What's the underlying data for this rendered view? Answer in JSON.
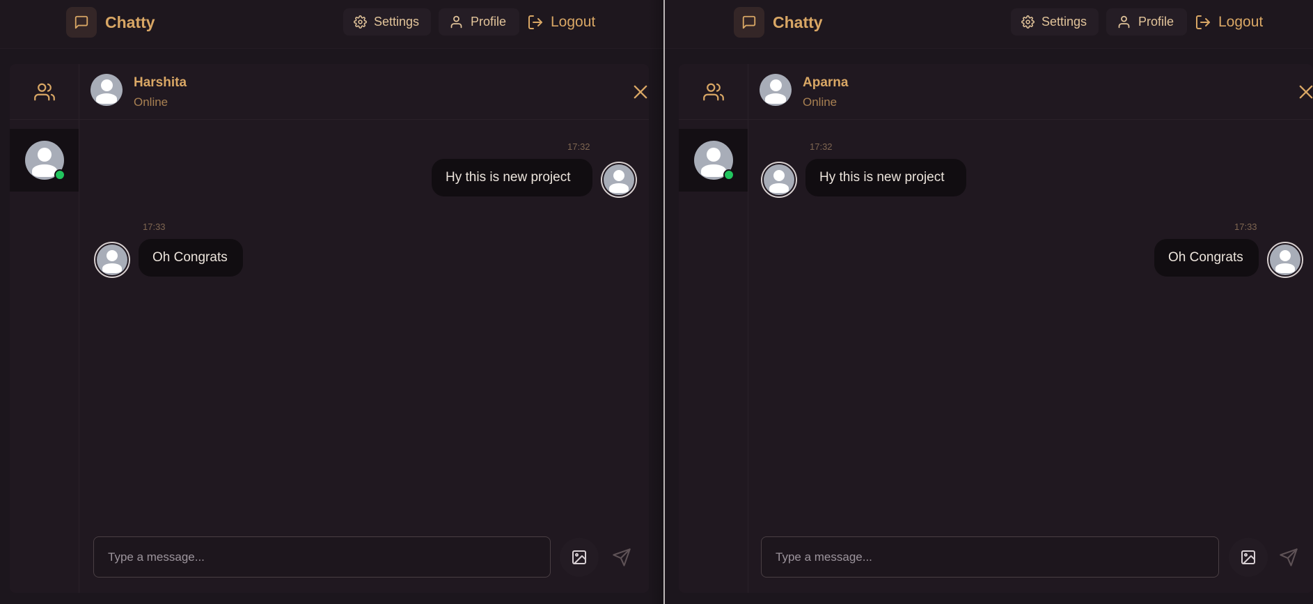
{
  "colors": {
    "accent": "#d9a765",
    "background": "#1c161d",
    "bubble": "#110d11",
    "online": "#22c55e"
  },
  "left": {
    "navbar": {
      "brand": "Chatty",
      "brand_icon": "message-square-icon",
      "settings_label": "Settings",
      "profile_label": "Profile",
      "logout_label": "Logout"
    },
    "sidebar": {
      "icon": "users-icon",
      "contact_online": true
    },
    "chat": {
      "peer_name": "Harshita",
      "peer_status": "Online",
      "messages": [
        {
          "time": "17:32",
          "text": "Hy this is new project",
          "side": "right"
        },
        {
          "time": "17:33",
          "text": "Oh Congrats",
          "side": "left"
        }
      ],
      "composer_placeholder": "Type a message..."
    }
  },
  "right": {
    "navbar": {
      "brand": "Chatty",
      "brand_icon": "message-square-icon",
      "settings_label": "Settings",
      "profile_label": "Profile",
      "logout_label": "Logout"
    },
    "sidebar": {
      "icon": "users-icon",
      "contact_online": true
    },
    "chat": {
      "peer_name": "Aparna",
      "peer_status": "Online",
      "messages": [
        {
          "time": "17:32",
          "text": "Hy this is new project",
          "side": "left"
        },
        {
          "time": "17:33",
          "text": "Oh Congrats",
          "side": "right"
        }
      ],
      "composer_placeholder": "Type a message..."
    }
  }
}
